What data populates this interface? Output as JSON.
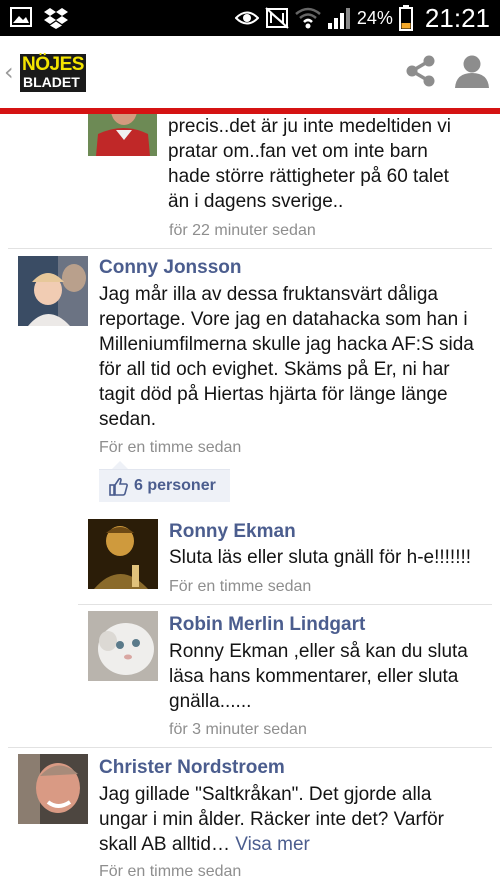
{
  "status_bar": {
    "left_icons": [
      "gallery-icon",
      "dropbox-icon"
    ],
    "right_icons": [
      "eye-icon",
      "nfc-icon",
      "wifi-icon",
      "signal-icon",
      "battery-icon"
    ],
    "battery_percent": "24%",
    "time": "21:21"
  },
  "header": {
    "logo_line1": "NÖJES",
    "logo_line2": "BLADET",
    "accent_color": "#d51313"
  },
  "comments": [
    {
      "author": "",
      "text": "precis..det är ju inte medeltiden vi pratar om..fan vet om inte barn hade större rättigheter på 60 talet än i dagens sverige..",
      "time": "för 22 minuter sedan"
    },
    {
      "author": "Conny Jonsson",
      "text": "Jag mår illa av dessa fruktansvärt dåliga reportage. Vore jag en datahacka som han i Milleniumfilmerna skulle jag hacka AF:S sida för all tid och evighet. Skäms på Er, ni har tagit död på Hiertas hjärta för länge länge sedan.",
      "time": "För en timme sedan",
      "likes": "6 personer"
    },
    {
      "author": "Ronny Ekman",
      "text": "Sluta läs eller sluta gnäll för h-e!!!!!!!",
      "time": "För en timme sedan"
    },
    {
      "author": "Robin Merlin Lindgart",
      "text": "Ronny Ekman ,eller så kan du sluta läsa hans kommentarer, eller sluta gnälla......",
      "time": "för 3 minuter sedan"
    },
    {
      "author": "Christer Nordstroem",
      "text": "Jag gillade \"Saltkråkan\". Det gjorde alla ungar i min ålder. Räcker inte det? Varför skall AB alltid…",
      "see_more": "Visa mer",
      "time": "För en timme sedan"
    }
  ]
}
